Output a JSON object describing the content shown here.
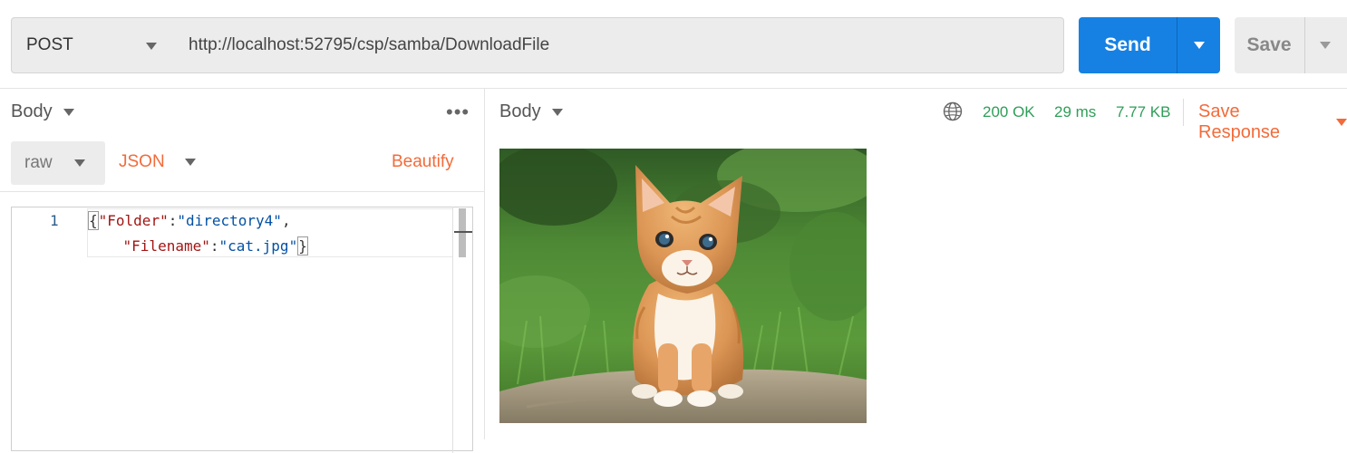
{
  "request": {
    "method": "POST",
    "url": "http://localhost:52795/csp/samba/DownloadFile",
    "send_label": "Send",
    "save_label": "Save"
  },
  "request_body": {
    "tab_label": "Body",
    "mode": "raw",
    "format": "JSON",
    "beautify_label": "Beautify",
    "line_number": "1",
    "code": {
      "line1": {
        "open": "{",
        "key": "\"Folder\"",
        "colon": ":",
        "value": "\"directory4\"",
        "comma": ","
      },
      "line2": {
        "key": "\"Filename\"",
        "colon": ":",
        "value": "\"cat.jpg\"",
        "close": "}"
      }
    }
  },
  "response": {
    "tab_label": "Body",
    "status": "200 OK",
    "time": "29 ms",
    "size": "7.77 KB",
    "save_response_label": "Save Response",
    "preview_image": "orange-kitten-photo"
  },
  "colors": {
    "accent_orange": "#f26b3a",
    "send_blue": "#1681e3",
    "status_green": "#2e9e58"
  }
}
